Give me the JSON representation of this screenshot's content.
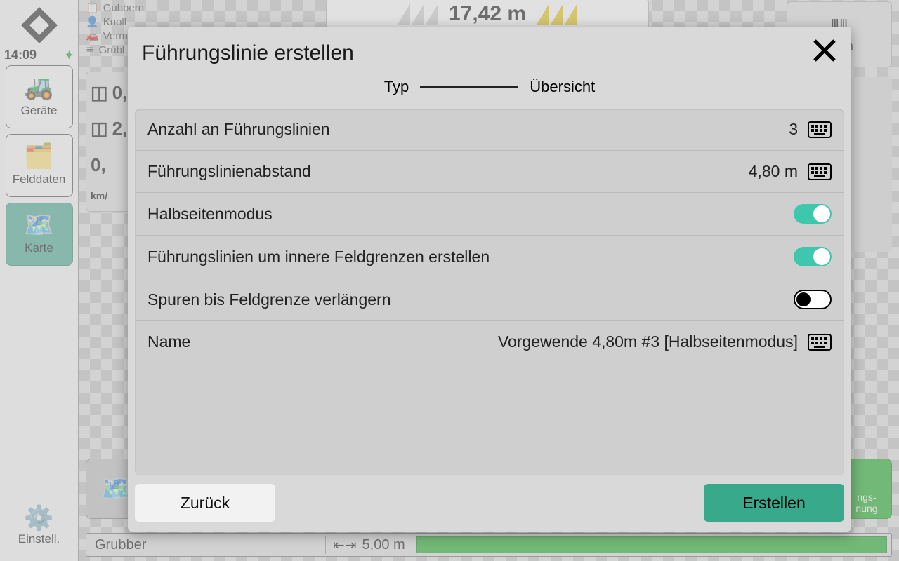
{
  "clock": "14:09",
  "sidebar": {
    "items": [
      {
        "label": "Geräte"
      },
      {
        "label": "Felddaten"
      },
      {
        "label": "Karte"
      }
    ],
    "settings": "Einstell."
  },
  "context": {
    "field": "Gubbern",
    "driver": "Knoll",
    "vehicle": "Verm",
    "implement_short": "Grübl"
  },
  "hud": {
    "width_value": "17,42 m",
    "linien": "linien",
    "ha1": "0,",
    "ha2": "2,",
    "speed": "0,",
    "speed_unit": "km/",
    "sections_line1": "ngs-",
    "sections_line2": "nung"
  },
  "bottom": {
    "implement": "Grubber",
    "work_width": "5,00 m"
  },
  "dialog": {
    "title": "Führungslinie erstellen",
    "step1": "Typ",
    "step2": "Übersicht",
    "rows": {
      "count_label": "Anzahl an Führungslinien",
      "count_value": "3",
      "spacing_label": "Führungslinienabstand",
      "spacing_value": "4,80 m",
      "halfside_label": "Halbseitenmodus",
      "inner_label": "Führungslinien um innere Feldgrenzen erstellen",
      "extend_label": "Spuren bis Feldgrenze verlängern",
      "name_label": "Name",
      "name_value": "Vorgewende 4,80m #3 [Halbseitenmodus]"
    },
    "toggles": {
      "halfside": true,
      "inner": true,
      "extend": false
    },
    "buttons": {
      "back": "Zurück",
      "create": "Erstellen"
    }
  }
}
